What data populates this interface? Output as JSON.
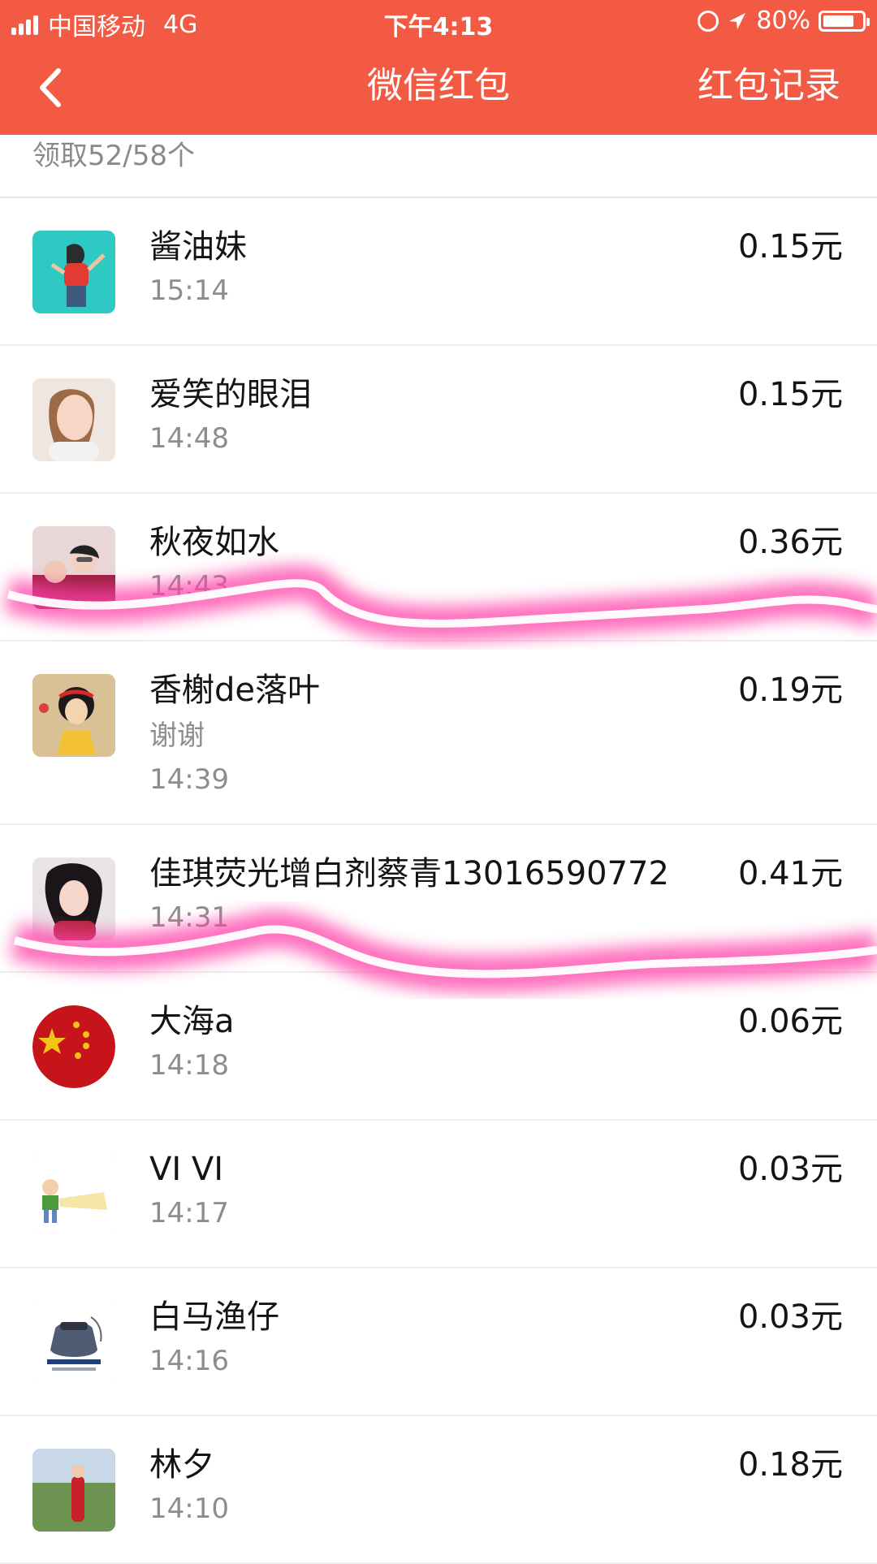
{
  "status_bar": {
    "carrier": "中国移动",
    "network": "4G",
    "time": "下午4:13",
    "battery": "80%",
    "battery_level": 0.8
  },
  "nav": {
    "title": "微信红包",
    "right_label": "红包记录"
  },
  "summary": {
    "text": "领取52/58个"
  },
  "items": [
    {
      "name": "酱油妹",
      "time": "15:14",
      "amount": "0.15元"
    },
    {
      "name": "爱笑的眼泪",
      "time": "14:48",
      "amount": "0.15元"
    },
    {
      "name": "秋夜如水",
      "time": "14:43",
      "amount": "0.36元"
    },
    {
      "name": "香榭de落叶",
      "note": "谢谢",
      "time": "14:39",
      "amount": "0.19元"
    },
    {
      "name": "佳琪荧光增白剂蔡青13016590772",
      "time": "14:31",
      "amount": "0.41元"
    },
    {
      "name": "大海a",
      "time": "14:18",
      "amount": "0.06元"
    },
    {
      "name": "VI VI",
      "time": "14:17",
      "amount": "0.03元"
    },
    {
      "name": "白马渔仔",
      "time": "14:16",
      "amount": "0.03元"
    },
    {
      "name": "林夕",
      "time": "14:10",
      "amount": "0.18元"
    }
  ],
  "colors": {
    "header": "#f25a43",
    "highlight": "#ff3fa8"
  }
}
